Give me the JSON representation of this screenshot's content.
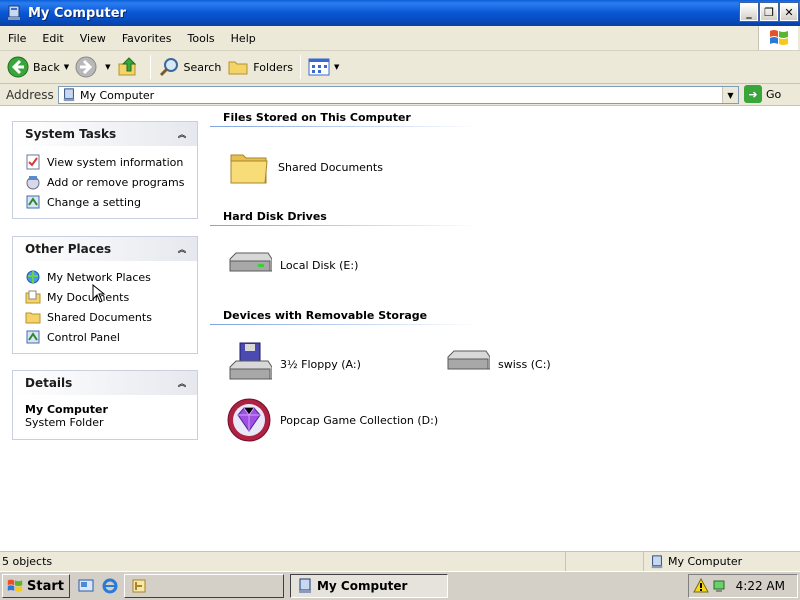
{
  "window": {
    "title": "My Computer",
    "buttons": {
      "minimize": "_",
      "restore": "❐",
      "close": "✕"
    }
  },
  "menu": [
    "File",
    "Edit",
    "View",
    "Favorites",
    "Tools",
    "Help"
  ],
  "toolbar": {
    "back": "Back",
    "search": "Search",
    "folders": "Folders"
  },
  "address": {
    "label": "Address",
    "value": "My Computer",
    "go": "Go"
  },
  "system_tasks": {
    "title": "System Tasks",
    "items": [
      "View system information",
      "Add or remove programs",
      "Change a setting"
    ]
  },
  "other_places": {
    "title": "Other Places",
    "items": [
      "My Network Places",
      "My Documents",
      "Shared Documents",
      "Control Panel"
    ]
  },
  "details": {
    "title": "Details",
    "name": "My Computer",
    "type": "System Folder"
  },
  "sections": {
    "files": {
      "title": "Files Stored on This Computer",
      "items": [
        "Shared Documents"
      ]
    },
    "hdd": {
      "title": "Hard Disk Drives",
      "items": [
        "Local Disk (E:)"
      ]
    },
    "removable": {
      "title": "Devices with Removable Storage",
      "items": [
        "3½ Floppy (A:)",
        "swiss (C:)",
        "Popcap Game Collection (D:)"
      ]
    }
  },
  "status": {
    "objects": "5 objects",
    "location": "My Computer"
  },
  "taskbar": {
    "start": "Start",
    "task_active": "My Computer",
    "clock": "4:22 AM"
  },
  "colors": {
    "titlebar": "#0957d4",
    "chrome": "#ece9d8",
    "section_line": "#7ea3e0"
  }
}
